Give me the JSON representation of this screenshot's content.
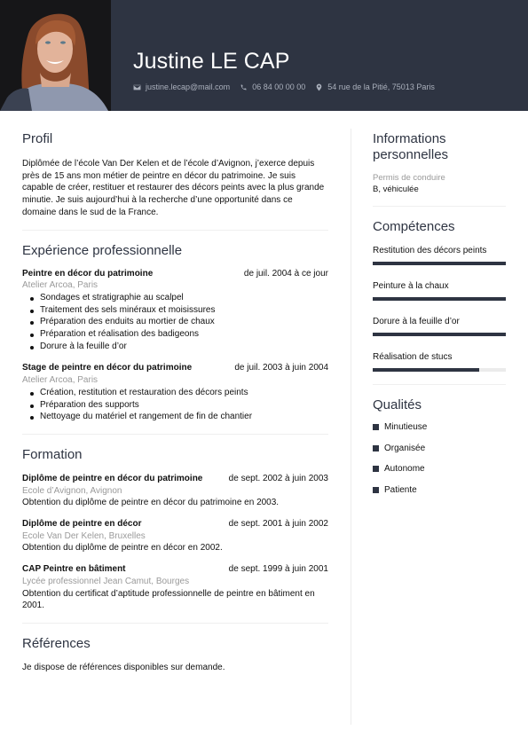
{
  "header": {
    "name": "Justine LE CAP",
    "contacts": [
      {
        "icon": "envelope-icon",
        "text": "justine.lecap@mail.com"
      },
      {
        "icon": "phone-icon",
        "text": "06 84 00 00 00"
      },
      {
        "icon": "map-pin-icon",
        "text": "54 rue de la Pitié, 75013 Paris"
      }
    ]
  },
  "profile": {
    "title": "Profil",
    "text": "Diplômée de l’école Van Der Kelen et de l’école d’Avignon, j’exerce depuis près de 15 ans mon métier de peintre en décor du patrimoine. Je suis capable de créer, restituer et restaurer des décors peints avec la plus grande minutie. Je suis aujourd’hui à la recherche d’une opportunité dans ce domaine dans le sud de la France."
  },
  "experience": {
    "title": "Expérience professionnelle",
    "items": [
      {
        "title": "Peintre en décor du patrimoine",
        "dates": "de juil. 2004 à ce jour",
        "place": "Atelier Arcoa, Paris",
        "bullets": [
          "Sondages et stratigraphie au scalpel",
          "Traitement des sels minéraux et moisissures",
          "Préparation des enduits au mortier de chaux",
          "Préparation et réalisation des badigeons",
          "Dorure à la feuille d’or"
        ]
      },
      {
        "title": "Stage de peintre en décor du patrimoine",
        "dates": "de juil. 2003 à juin 2004",
        "place": "Atelier Arcoa, Paris",
        "bullets": [
          "Création, restitution et restauration des décors peints",
          "Préparation des supports",
          "Nettoyage du matériel et rangement de fin de chantier"
        ]
      }
    ]
  },
  "education": {
    "title": "Formation",
    "items": [
      {
        "title": "Diplôme de peintre en décor du patrimoine",
        "dates": "de sept. 2002 à juin 2003",
        "place": "Ecole d’Avignon, Avignon",
        "desc": "Obtention du diplôme de peintre en décor du patrimoine en 2003."
      },
      {
        "title": "Diplôme de peintre en décor",
        "dates": "de sept. 2001 à juin 2002",
        "place": "Ecole Van Der Kelen, Bruxelles",
        "desc": "Obtention du diplôme de peintre en décor en 2002."
      },
      {
        "title": "CAP Peintre en bâtiment",
        "dates": "de sept. 1999 à juin 2001",
        "place": "Lycée professionnel Jean Camut, Bourges",
        "desc": "Obtention du certificat d’aptitude professionnelle de peintre en bâtiment en 2001."
      }
    ]
  },
  "references": {
    "title": "Références",
    "text": "Je dispose de références disponibles sur demande."
  },
  "personal": {
    "title": "Informations personnelles",
    "items": [
      {
        "label": "Permis de conduire",
        "value": "B, véhiculée"
      }
    ]
  },
  "skills": {
    "title": "Compétences",
    "items": [
      {
        "label": "Restitution des décors peints",
        "level_percent": 100
      },
      {
        "label": "Peinture à la chaux",
        "level_percent": 100
      },
      {
        "label": "Dorure à la feuille d’or",
        "level_percent": 100
      },
      {
        "label": "Réalisation de stucs",
        "level_percent": 80
      }
    ]
  },
  "qualities": {
    "title": "Qualités",
    "items": [
      "Minutieuse",
      "Organisée",
      "Autonome",
      "Patiente"
    ]
  },
  "colors": {
    "accent": "#2e3442",
    "muted_text": "#9a9a9a",
    "divider": "#efefef"
  }
}
